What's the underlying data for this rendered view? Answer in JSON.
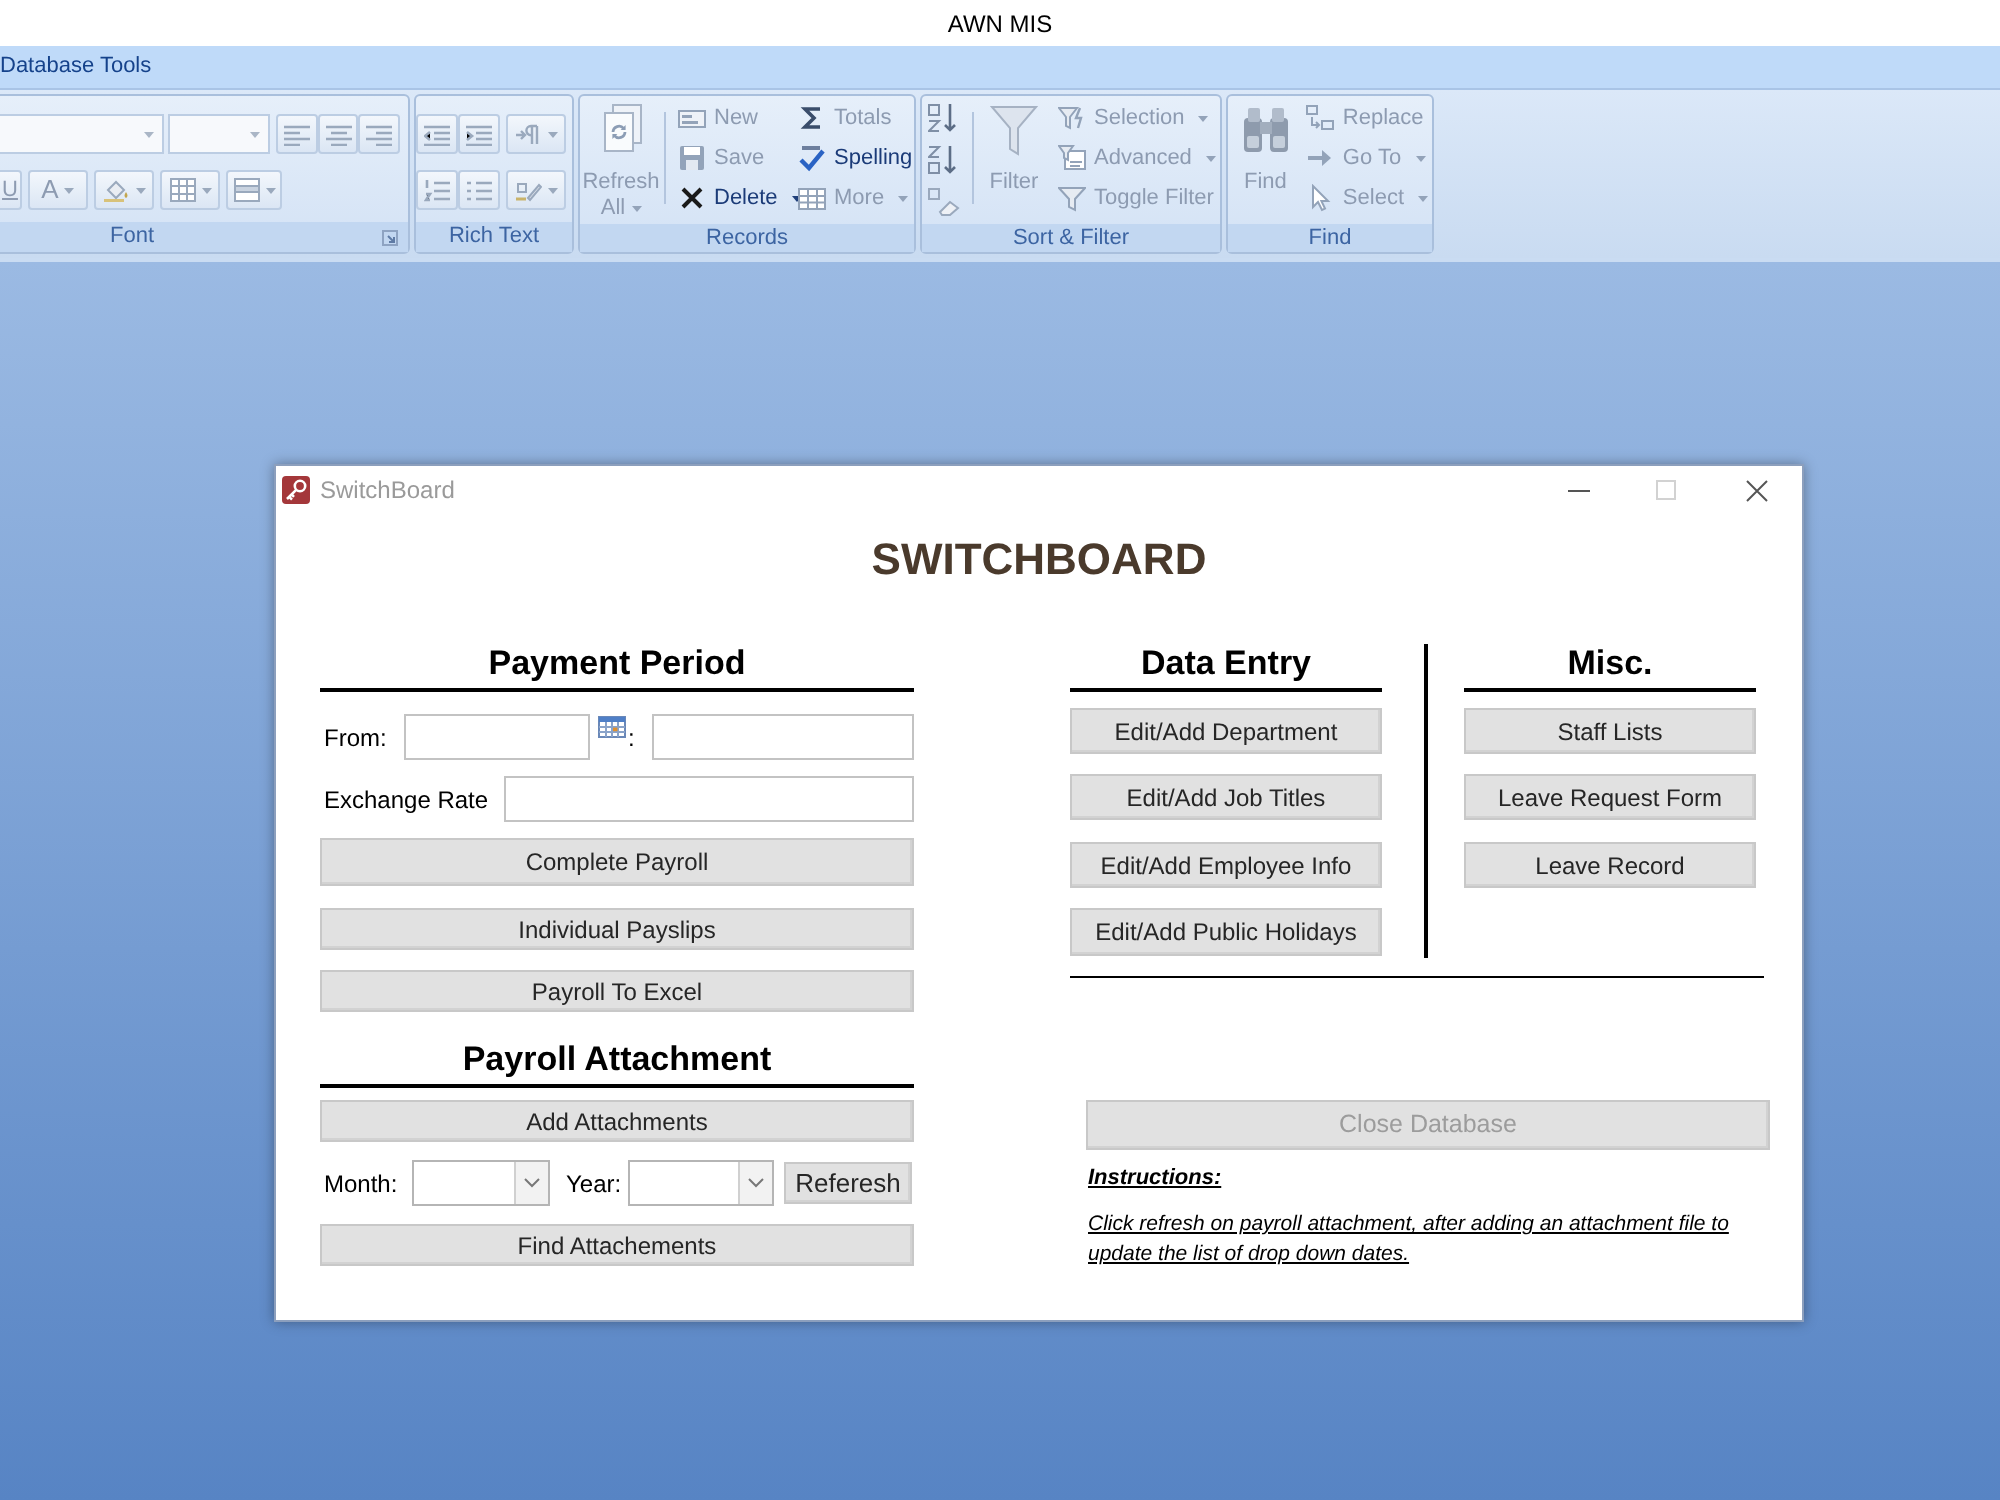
{
  "window": {
    "title": "AWN MIS"
  },
  "ribbon": {
    "tab": "Database Tools",
    "groups": [
      {
        "kind": "font",
        "label": "Font",
        "launcher": true,
        "underline_label": "U",
        "font_color_label": "A"
      },
      {
        "kind": "rich_text",
        "label": "Rich Text"
      },
      {
        "kind": "records",
        "label": "Records",
        "large": {
          "lines": [
            "Refresh",
            "All"
          ],
          "dropdown": true,
          "disabled": true
        },
        "items": [
          {
            "label": "New",
            "disabled": true
          },
          {
            "label": "Save",
            "disabled": true
          },
          {
            "label": "Delete",
            "disabled": false,
            "dropdown": true
          },
          {
            "label": "Totals",
            "disabled": true
          },
          {
            "label": "Spelling",
            "disabled": false
          },
          {
            "label": "More",
            "disabled": true,
            "dropdown": true
          }
        ]
      },
      {
        "kind": "sort_filter",
        "label": "Sort & Filter",
        "large": {
          "lines": [
            "Filter"
          ],
          "disabled": true
        },
        "items": [
          {
            "label": "Selection",
            "disabled": true,
            "dropdown": true
          },
          {
            "label": "Advanced",
            "disabled": true,
            "dropdown": true
          },
          {
            "label": "Toggle Filter",
            "disabled": true
          }
        ]
      },
      {
        "kind": "find",
        "label": "Find",
        "large": {
          "lines": [
            "Find"
          ],
          "disabled": true
        },
        "items": [
          {
            "label": "Replace",
            "disabled": true
          },
          {
            "label": "Go To",
            "disabled": true,
            "dropdown": true
          },
          {
            "label": "Select",
            "disabled": true,
            "dropdown": true
          }
        ]
      }
    ]
  },
  "dialog": {
    "title": "SwitchBoard",
    "maximize_disabled": true,
    "heading": "SWITCHBOARD",
    "payment_period": {
      "heading": "Payment Period",
      "from_label": "From:",
      "to_label": ":",
      "exchange_rate_label": "Exchange Rate",
      "buttons": [
        "Complete Payroll",
        "Individual Payslips",
        "Payroll To Excel"
      ]
    },
    "payroll_attachment": {
      "heading": "Payroll Attachment",
      "add_button": "Add Attachments",
      "month_label": "Month:",
      "year_label": "Year:",
      "refresh_button": "Referesh",
      "find_button": "Find Attachements"
    },
    "data_entry": {
      "heading": "Data Entry",
      "buttons": [
        "Edit/Add Department",
        "Edit/Add Job Titles",
        "Edit/Add Employee Info",
        "Edit/Add Public Holidays"
      ]
    },
    "misc": {
      "heading": "Misc.",
      "buttons": [
        "Staff Lists",
        "Leave Request Form",
        "Leave Record"
      ]
    },
    "close_button": {
      "label": "Close Database",
      "disabled": true
    },
    "instructions": {
      "heading": "Instructions:",
      "text": "Click refresh on payroll attachment, after adding an attachment file to update the list of drop down dates."
    }
  }
}
